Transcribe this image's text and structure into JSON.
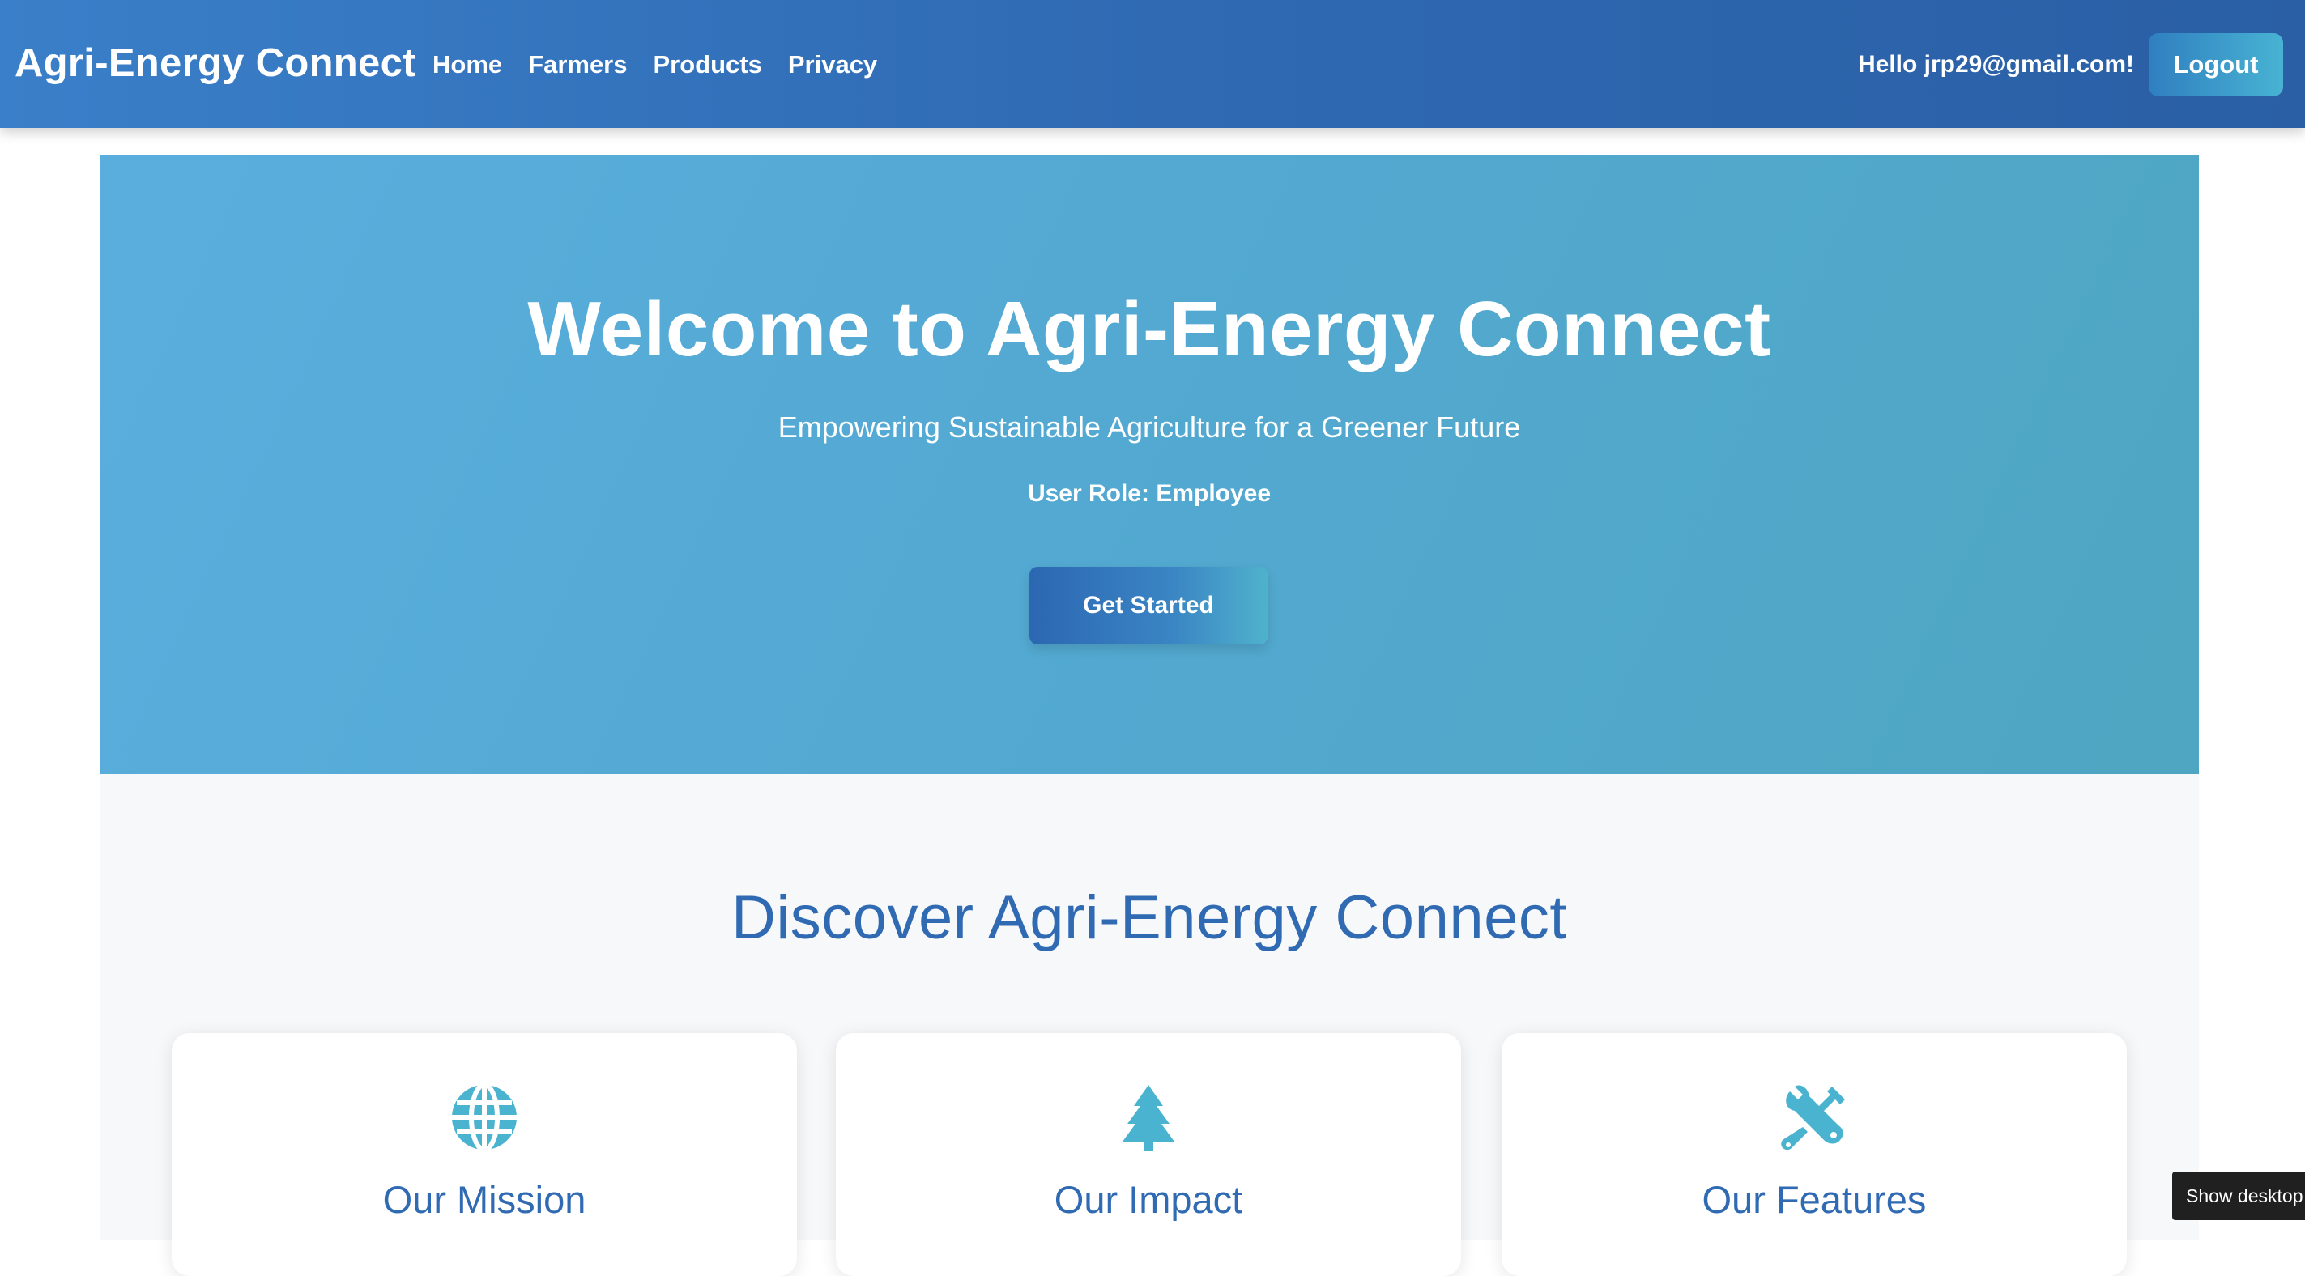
{
  "navbar": {
    "brand": "Agri-Energy Connect",
    "links": [
      "Home",
      "Farmers",
      "Products",
      "Privacy"
    ],
    "greeting": "Hello jrp29@gmail.com!",
    "logout_label": "Logout"
  },
  "hero": {
    "title": "Welcome to Agri-Energy Connect",
    "subtitle": "Empowering Sustainable Agriculture for a Greener Future",
    "role": "User Role: Employee",
    "cta_label": "Get Started"
  },
  "discover": {
    "title": "Discover Agri-Energy Connect",
    "cards": [
      {
        "title": "Our Mission",
        "icon": "globe-icon"
      },
      {
        "title": "Our Impact",
        "icon": "tree-icon"
      },
      {
        "title": "Our Features",
        "icon": "tools-icon"
      }
    ]
  },
  "tooltip": {
    "text": "Show desktop"
  },
  "colors": {
    "nav_bg": "#2f6ab3",
    "hero_bg": "#53a9d2",
    "accent": "#2f6ab3",
    "icon": "#4ab3d0"
  }
}
